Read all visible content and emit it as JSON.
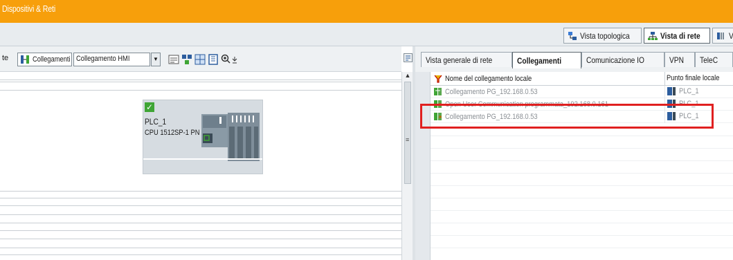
{
  "window": {
    "title": "Dispositivi & Reti"
  },
  "view_tabs": [
    {
      "label": "Vista topologica",
      "icon": "topology-view-icon",
      "active": false
    },
    {
      "label": "Vista di rete",
      "icon": "network-view-icon",
      "active": true
    },
    {
      "label": "V",
      "icon": "device-view-icon",
      "active": false
    }
  ],
  "left_toolbar": {
    "cut_label": "te",
    "connections_label": "Collegamenti",
    "connection_type_value": "Collegamento HMI"
  },
  "device": {
    "name": "PLC_1",
    "cpu": "CPU 1512SP-1 PN",
    "status_icon": "check-ok-icon"
  },
  "right_tabs": [
    {
      "label": "Vista generale di rete",
      "active": false
    },
    {
      "label": "Collegamenti",
      "active": true
    },
    {
      "label": "Comunicazione IO",
      "active": false
    },
    {
      "label": "VPN",
      "active": false
    },
    {
      "label": "TeleC",
      "active": false
    }
  ],
  "connections_table": {
    "columns": [
      "Nome del collegamento locale",
      "Punto finale locale"
    ],
    "rows": [
      {
        "name": "Collegamento PG_192.168.0.53",
        "endpoint": "PLC_1"
      },
      {
        "name": "Open User Communication programmata_192.168.0.161",
        "endpoint": "PLC_1",
        "highlighted": true
      },
      {
        "name": "Collegamento PG_192.168.0.53",
        "endpoint": "PLC_1"
      }
    ]
  },
  "colors": {
    "titlebar": "#f79f0b",
    "highlight": "#e02020",
    "ok_green": "#3fa535"
  }
}
